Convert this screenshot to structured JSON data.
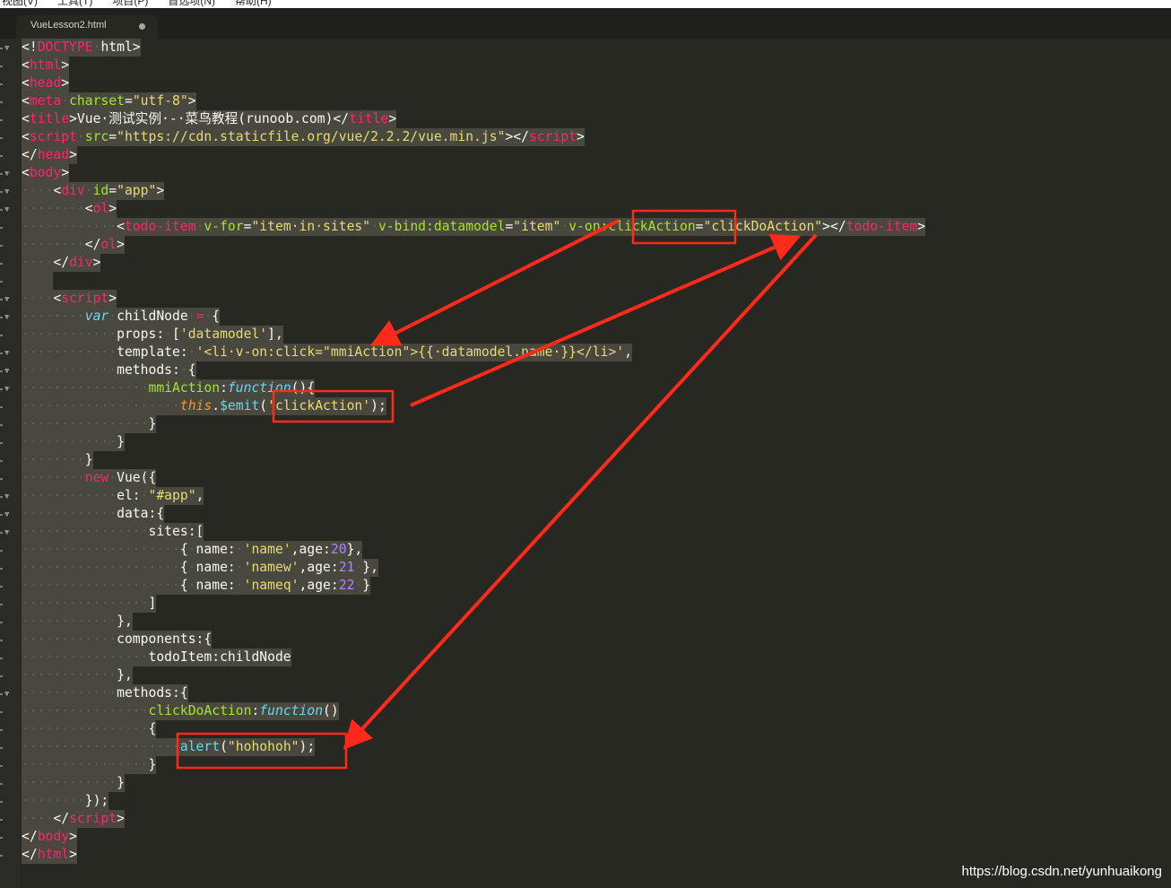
{
  "menubar": {
    "items": [
      "视图(V)",
      "工具(T)",
      "项目(P)",
      "首选项(N)",
      "帮助(H)"
    ]
  },
  "tab": {
    "filename": "VueLesson2.html"
  },
  "watermark": "https://blog.csdn.net/yunhuaikong",
  "colors": {
    "background": "#272822",
    "tag": "#f92672",
    "attribute": "#a6e22e",
    "string": "#e6db74",
    "annotation": "#ff2a1a"
  },
  "code": {
    "lines": [
      [
        [
          "p",
          "<!"
        ],
        [
          "tag",
          "DOCTYPE"
        ],
        [
          "ws",
          "·"
        ],
        [
          "p",
          "html>"
        ]
      ],
      [
        [
          "p",
          "<"
        ],
        [
          "tag",
          "html"
        ],
        [
          "p",
          ">"
        ]
      ],
      [
        [
          "p",
          "<"
        ],
        [
          "tag",
          "head"
        ],
        [
          "p",
          ">"
        ]
      ],
      [
        [
          "p",
          "<"
        ],
        [
          "tag",
          "meta"
        ],
        [
          "ws",
          "·"
        ],
        [
          "attr",
          "charset"
        ],
        [
          "p",
          "="
        ],
        [
          "str",
          "\"utf-8\""
        ],
        [
          "p",
          ">"
        ]
      ],
      [
        [
          "p",
          "<"
        ],
        [
          "tag",
          "title"
        ],
        [
          "p",
          ">Vue·测试实例·-·菜鸟教程(runoob.com)</"
        ],
        [
          "tag",
          "title"
        ],
        [
          "p",
          ">"
        ]
      ],
      [
        [
          "p",
          "<"
        ],
        [
          "tag",
          "script"
        ],
        [
          "ws",
          "·"
        ],
        [
          "attr",
          "src"
        ],
        [
          "p",
          "="
        ],
        [
          "str",
          "\"https://cdn.staticfile.org/vue/2.2.2/vue.min.js\""
        ],
        [
          "p",
          "></"
        ],
        [
          "tag",
          "script"
        ],
        [
          "p",
          ">"
        ]
      ],
      [
        [
          "p",
          "</"
        ],
        [
          "tag",
          "head"
        ],
        [
          "p",
          ">"
        ]
      ],
      [
        [
          "p",
          "<"
        ],
        [
          "tag",
          "body"
        ],
        [
          "p",
          ">"
        ]
      ],
      [
        [
          "ws",
          "····"
        ],
        [
          "p",
          "<"
        ],
        [
          "tag",
          "div"
        ],
        [
          "ws",
          "·"
        ],
        [
          "attr",
          "id"
        ],
        [
          "p",
          "="
        ],
        [
          "str",
          "\"app\""
        ],
        [
          "p",
          ">"
        ]
      ],
      [
        [
          "ws",
          "········"
        ],
        [
          "p",
          "<"
        ],
        [
          "tag",
          "ol"
        ],
        [
          "p",
          ">"
        ]
      ],
      [
        [
          "ws",
          "············"
        ],
        [
          "p",
          "<"
        ],
        [
          "tag",
          "todo-item"
        ],
        [
          "ws",
          "·"
        ],
        [
          "attr",
          "v-for"
        ],
        [
          "p",
          "="
        ],
        [
          "str",
          "\"item·in·sites\""
        ],
        [
          "ws",
          "·"
        ],
        [
          "attr",
          "v-bind:datamodel"
        ],
        [
          "p",
          "="
        ],
        [
          "str",
          "\"item\""
        ],
        [
          "ws",
          "·"
        ],
        [
          "attr",
          "v-on:clickAction"
        ],
        [
          "p",
          "="
        ],
        [
          "str",
          "\"clickDoAction\""
        ],
        [
          "p",
          "></"
        ],
        [
          "tag",
          "todo-item"
        ],
        [
          "p",
          ">"
        ]
      ],
      [
        [
          "ws",
          "········"
        ],
        [
          "p",
          "</"
        ],
        [
          "tag",
          "ol"
        ],
        [
          "p",
          ">"
        ]
      ],
      [
        [
          "ws",
          "····"
        ],
        [
          "p",
          "</"
        ],
        [
          "tag",
          "div"
        ],
        [
          "p",
          ">"
        ]
      ],
      [
        [
          "ws",
          "    "
        ]
      ],
      [
        [
          "ws",
          "····"
        ],
        [
          "p",
          "<"
        ],
        [
          "tag",
          "script"
        ],
        [
          "p",
          ">"
        ]
      ],
      [
        [
          "ws",
          "········"
        ],
        [
          "kw",
          "var"
        ],
        [
          "ws",
          "·"
        ],
        [
          "p",
          "childNode"
        ],
        [
          "ws",
          "·"
        ],
        [
          "kw2",
          "="
        ],
        [
          "ws",
          "·"
        ],
        [
          "p",
          "{"
        ]
      ],
      [
        [
          "ws",
          "············"
        ],
        [
          "p",
          "props:"
        ],
        [
          "ws",
          "·"
        ],
        [
          "p",
          "["
        ],
        [
          "str",
          "'datamodel'"
        ],
        [
          "p",
          "],"
        ]
      ],
      [
        [
          "ws",
          "············"
        ],
        [
          "p",
          "template:"
        ],
        [
          "ws",
          "·"
        ],
        [
          "str",
          "'<li·v-on:click=\"mmiAction\">{{·datamodel.name·}}</li>'"
        ],
        [
          "p",
          ","
        ]
      ],
      [
        [
          "ws",
          "············"
        ],
        [
          "p",
          "methods:"
        ],
        [
          "ws",
          "·"
        ],
        [
          "p",
          "{"
        ]
      ],
      [
        [
          "ws",
          "················"
        ],
        [
          "fn",
          "mmiAction"
        ],
        [
          "p",
          ":"
        ],
        [
          "kw",
          "function"
        ],
        [
          "p",
          "(){"
        ]
      ],
      [
        [
          "ws",
          "····················"
        ],
        [
          "thisk",
          "this"
        ],
        [
          "p",
          "."
        ],
        [
          "emit",
          "$emit"
        ],
        [
          "p",
          "("
        ],
        [
          "str",
          "'clickAction'"
        ],
        [
          "p",
          ");"
        ]
      ],
      [
        [
          "ws",
          "················"
        ],
        [
          "p",
          "}"
        ]
      ],
      [
        [
          "ws",
          "············"
        ],
        [
          "p",
          "}"
        ]
      ],
      [
        [
          "ws",
          "········"
        ],
        [
          "p",
          "}"
        ]
      ],
      [
        [
          "ws",
          "········"
        ],
        [
          "kw2",
          "new"
        ],
        [
          "ws",
          "·"
        ],
        [
          "p",
          "Vue({"
        ]
      ],
      [
        [
          "ws",
          "············"
        ],
        [
          "p",
          "el:"
        ],
        [
          "ws",
          "·"
        ],
        [
          "str",
          "\"#app\""
        ],
        [
          "p",
          ","
        ]
      ],
      [
        [
          "ws",
          "············"
        ],
        [
          "p",
          "data:{"
        ]
      ],
      [
        [
          "ws",
          "················"
        ],
        [
          "p",
          "sites:["
        ]
      ],
      [
        [
          "ws",
          "····················"
        ],
        [
          "p",
          "{"
        ],
        [
          "ws",
          "·"
        ],
        [
          "p",
          "name:"
        ],
        [
          "ws",
          "·"
        ],
        [
          "str",
          "'name'"
        ],
        [
          "p",
          ",age:"
        ],
        [
          "num",
          "20"
        ],
        [
          "p",
          "},"
        ]
      ],
      [
        [
          "ws",
          "····················"
        ],
        [
          "p",
          "{"
        ],
        [
          "ws",
          "·"
        ],
        [
          "p",
          "name:"
        ],
        [
          "ws",
          "·"
        ],
        [
          "str",
          "'namew'"
        ],
        [
          "p",
          ",age:"
        ],
        [
          "num",
          "21"
        ],
        [
          "ws",
          "·"
        ],
        [
          "p",
          "},"
        ]
      ],
      [
        [
          "ws",
          "····················"
        ],
        [
          "p",
          "{"
        ],
        [
          "ws",
          "·"
        ],
        [
          "p",
          "name:"
        ],
        [
          "ws",
          "·"
        ],
        [
          "str",
          "'nameq'"
        ],
        [
          "p",
          ",age:"
        ],
        [
          "num",
          "22"
        ],
        [
          "ws",
          "·"
        ],
        [
          "p",
          "}"
        ]
      ],
      [
        [
          "ws",
          "················"
        ],
        [
          "p",
          "]"
        ]
      ],
      [
        [
          "ws",
          "············"
        ],
        [
          "p",
          "},"
        ]
      ],
      [
        [
          "ws",
          "············"
        ],
        [
          "p",
          "components:{"
        ]
      ],
      [
        [
          "ws",
          "················"
        ],
        [
          "p",
          "todoItem:childNode"
        ]
      ],
      [
        [
          "ws",
          "············"
        ],
        [
          "p",
          "},"
        ]
      ],
      [
        [
          "ws",
          "············"
        ],
        [
          "p",
          "methods:{"
        ]
      ],
      [
        [
          "ws",
          "················"
        ],
        [
          "fn",
          "clickDoAction"
        ],
        [
          "p",
          ":"
        ],
        [
          "kw",
          "function"
        ],
        [
          "p",
          "()"
        ]
      ],
      [
        [
          "ws",
          "················"
        ],
        [
          "p",
          "{"
        ]
      ],
      [
        [
          "ws",
          "····················"
        ],
        [
          "emit",
          "alert"
        ],
        [
          "p",
          "("
        ],
        [
          "str",
          "\"hohohoh\""
        ],
        [
          "p",
          ");"
        ]
      ],
      [
        [
          "ws",
          "················"
        ],
        [
          "p",
          "}"
        ]
      ],
      [
        [
          "ws",
          "············"
        ],
        [
          "p",
          "}"
        ]
      ],
      [
        [
          "ws",
          "········"
        ],
        [
          "p",
          "});"
        ]
      ],
      [
        [
          "ws",
          "····"
        ],
        [
          "p",
          "</"
        ],
        [
          "tag",
          "script"
        ],
        [
          "p",
          ">"
        ]
      ],
      [
        [
          "p",
          "</"
        ],
        [
          "tag",
          "body"
        ],
        [
          "p",
          ">"
        ]
      ],
      [
        [
          "p",
          "</"
        ],
        [
          "tag",
          "html"
        ],
        [
          "p",
          ">"
        ]
      ]
    ]
  }
}
